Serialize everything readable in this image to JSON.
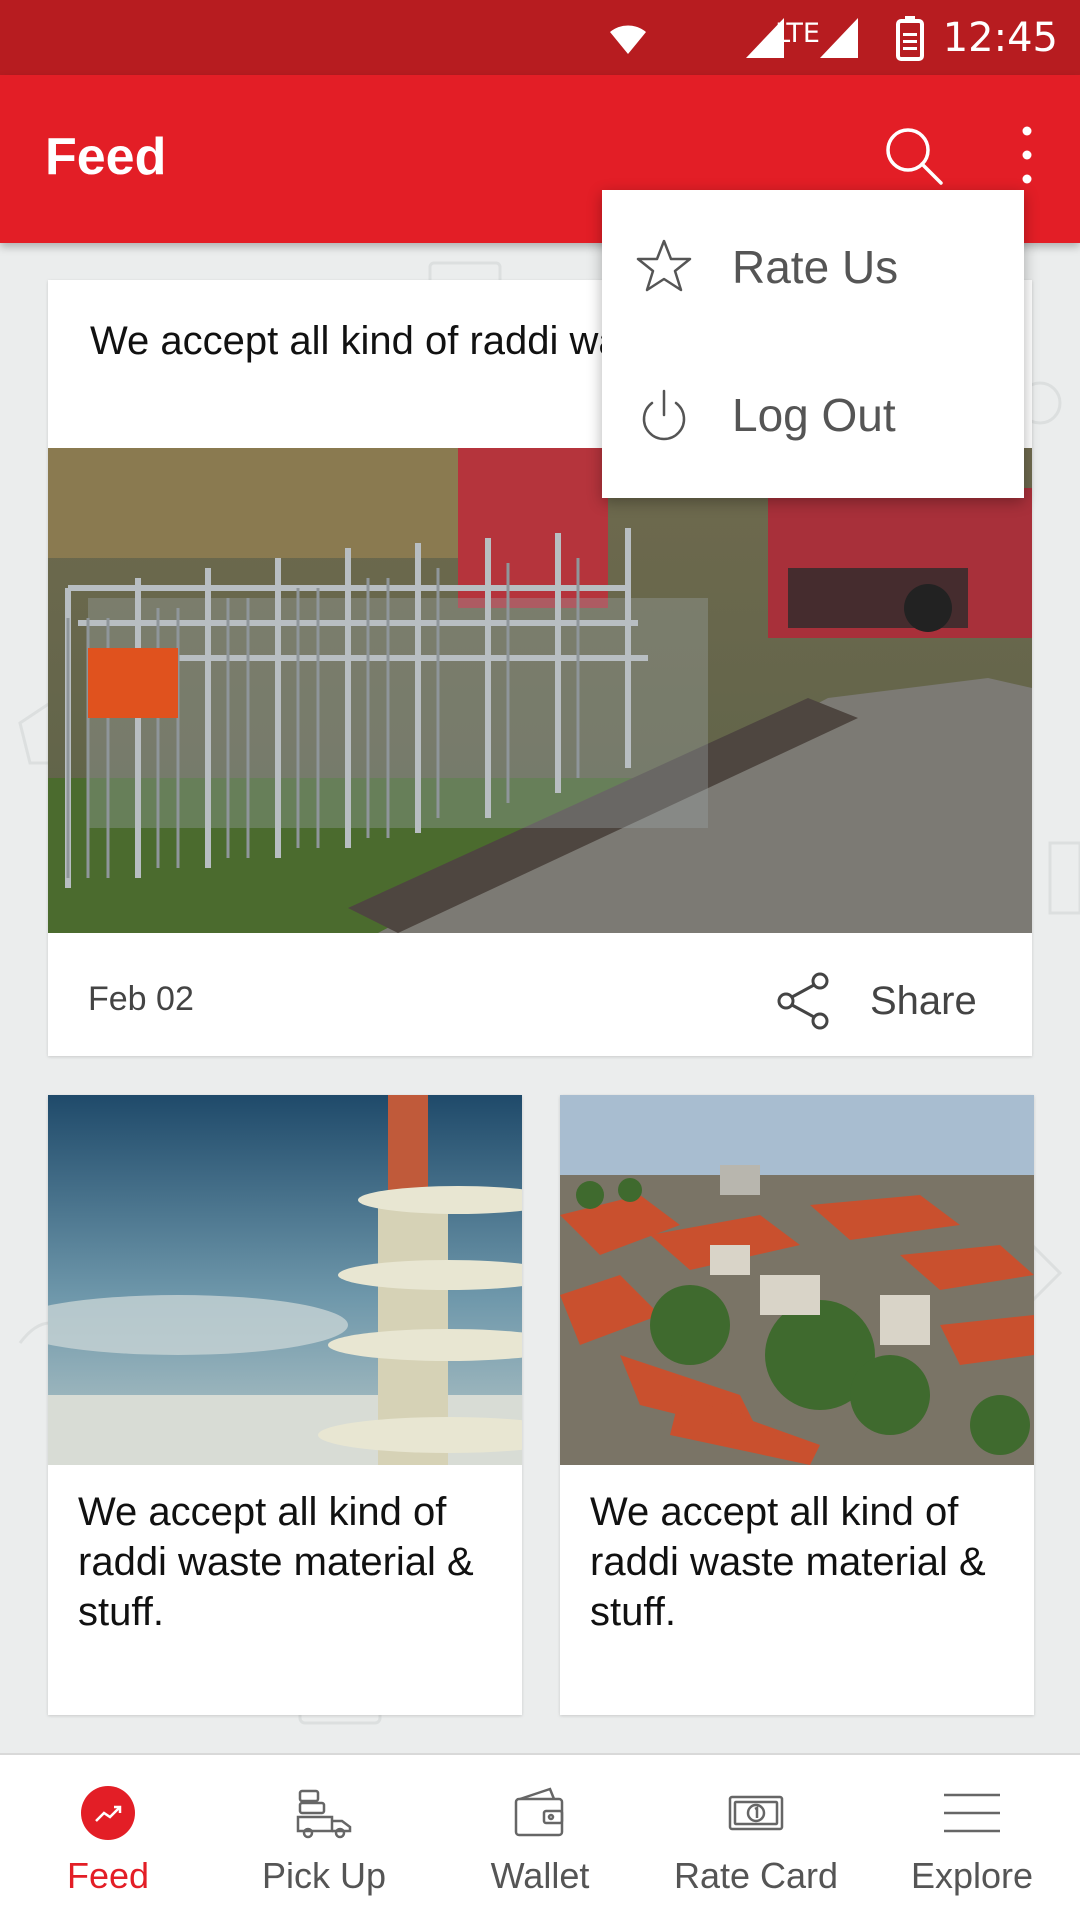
{
  "status_bar": {
    "time": "12:45",
    "network": "LTE"
  },
  "app_bar": {
    "title": "Feed"
  },
  "menu": {
    "items": [
      {
        "label": "Rate Us",
        "icon": "star-icon"
      },
      {
        "label": "Log Out",
        "icon": "power-icon"
      }
    ]
  },
  "feed": {
    "main_card": {
      "title": "We accept all kind of raddi waste material & stuff.",
      "date": "Feb 02",
      "share_label": "Share",
      "image": "scrap-yard-barriers-photo"
    },
    "small_cards": [
      {
        "title": "We accept all kind of raddi waste material & stuff.",
        "image": "frosted-tower-photo"
      },
      {
        "title": "We accept all kind of raddi waste material & stuff.",
        "image": "city-rooftops-photo"
      }
    ]
  },
  "bottom_nav": {
    "items": [
      {
        "label": "Feed",
        "icon": "trending-icon",
        "active": true
      },
      {
        "label": "Pick Up",
        "icon": "truck-icon",
        "active": false
      },
      {
        "label": "Wallet",
        "icon": "wallet-icon",
        "active": false
      },
      {
        "label": "Rate Card",
        "icon": "banknote-icon",
        "active": false
      },
      {
        "label": "Explore",
        "icon": "menu-lines-icon",
        "active": false
      }
    ]
  },
  "colors": {
    "primary": "#e31e26",
    "status_bar": "#b71c20",
    "background": "#ebeded"
  }
}
